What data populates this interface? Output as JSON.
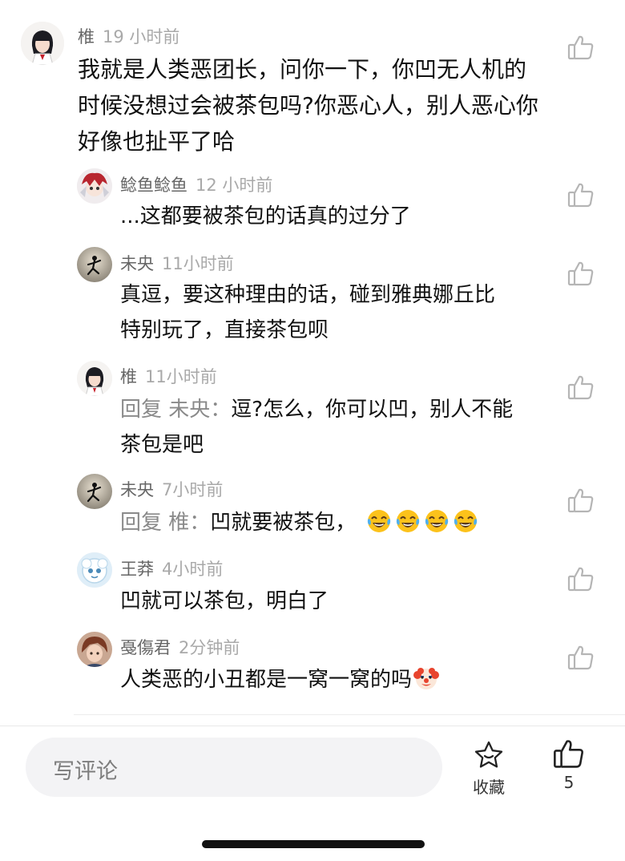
{
  "comments": [
    {
      "user": "椎",
      "time": "19 小时前",
      "lines": [
        "我就是人类恶团长，问你一下，你凹无人机的",
        "时候没想过会被茶包吗?你恶心人，别人恶心你",
        "好像也扯平了哈"
      ]
    },
    {
      "user": "鲶鱼鲶鱼",
      "time": "12 小时前",
      "lines": [
        "...这都要被茶包的话真的过分了"
      ]
    },
    {
      "user": "未央",
      "time": "11小时前",
      "lines": [
        "真逗，要这种理由的话，碰到雅典娜丘比",
        "特别玩了，直接茶包呗"
      ]
    },
    {
      "user": "椎",
      "time": "11小时前",
      "reply_prefix": "回复 未央：",
      "lines": [
        "逗?怎么，你可以凹，别人不能",
        "茶包是吧"
      ]
    },
    {
      "user": "未央",
      "time": "7小时前",
      "reply_prefix": "回复 椎：",
      "lines": [
        "凹就要被茶包，"
      ],
      "emoji": "tears-of-joy x4"
    },
    {
      "user": "王莽",
      "time": "4小时前",
      "lines": [
        "凹就可以茶包，明白了"
      ]
    },
    {
      "user": "戞傷君",
      "time": "2分钟前",
      "lines": [
        "人类恶的小丑都是一窝一窝的吗"
      ],
      "emoji": "clown-face"
    }
  ],
  "footer": {
    "input_placeholder": "写评论",
    "collect_label": "收藏",
    "like_count": "5"
  },
  "colors": {
    "username": "#666666",
    "time": "#a9a9a9",
    "text": "#111111",
    "reply_prefix": "#8a8a8a",
    "input_bg": "#f3f3f5"
  }
}
